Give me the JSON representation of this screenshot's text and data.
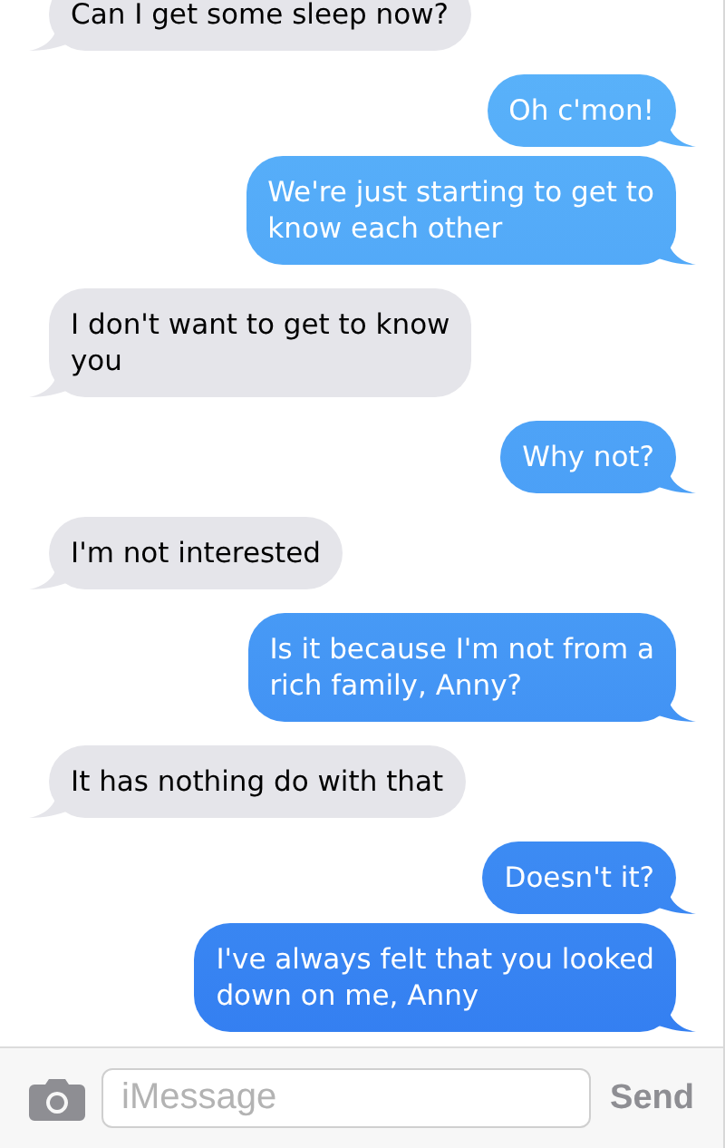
{
  "messages": [
    {
      "kind": "received",
      "lines": [
        "Can I get some sleep now?"
      ]
    },
    {
      "kind": "sent",
      "lines": [
        "Oh c'mon!"
      ]
    },
    {
      "kind": "sent",
      "lines": [
        "We're just starting to get to",
        "know each other"
      ]
    },
    {
      "kind": "received",
      "lines": [
        "I don't want to get to know",
        "you"
      ]
    },
    {
      "kind": "sent",
      "lines": [
        "Why not?"
      ]
    },
    {
      "kind": "received",
      "lines": [
        "I'm not interested"
      ]
    },
    {
      "kind": "sent",
      "lines": [
        "Is it because I'm not from a",
        "rich family, Anny?"
      ]
    },
    {
      "kind": "received",
      "lines": [
        "It has nothing do with that"
      ]
    },
    {
      "kind": "sent",
      "lines": [
        "Doesn't it?"
      ]
    },
    {
      "kind": "sent",
      "lines": [
        "I've always felt that you looked",
        "down on me, Anny"
      ]
    }
  ],
  "composer": {
    "placeholder": "iMessage",
    "send": {
      "label": "Send",
      "disabled": true
    }
  }
}
